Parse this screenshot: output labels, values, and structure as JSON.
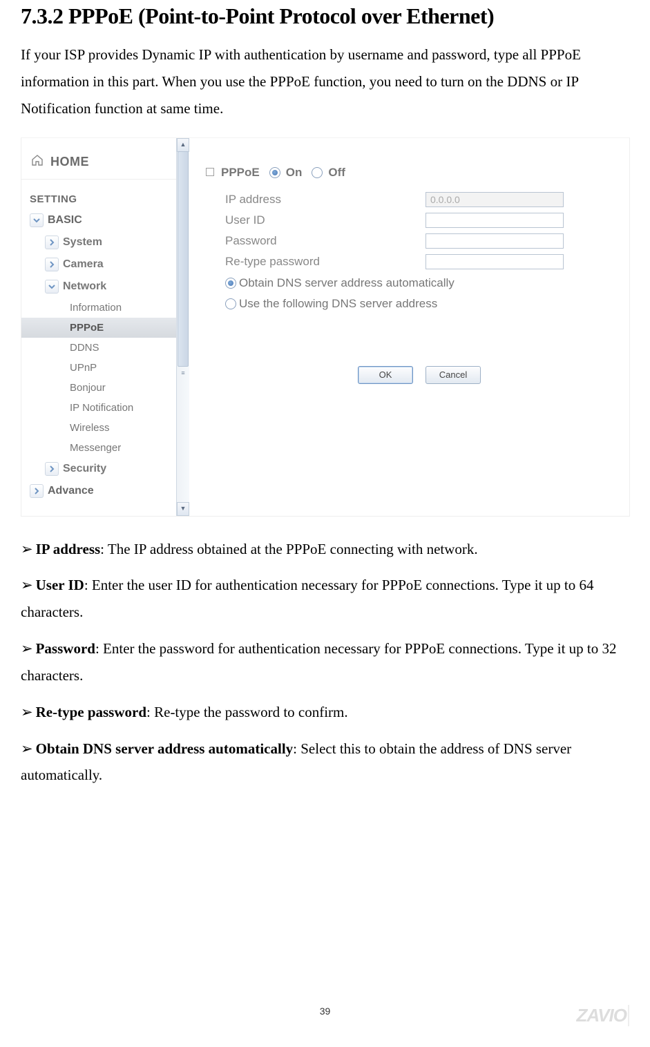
{
  "heading": "7.3.2 PPPoE (Point-to-Point Protocol over Ethernet)",
  "intro": "If your ISP provides Dynamic IP with authentication by username and password, type all PPPoE information in this part. When you use the PPPoE function, you need to turn on the DDNS or IP Notification function at same time.",
  "nav": {
    "home": "HOME",
    "settingHeader": "SETTING",
    "basic": "BASIC",
    "system": "System",
    "camera": "Camera",
    "network": "Network",
    "items": {
      "information": "Information",
      "pppoe": "PPPoE",
      "ddns": "DDNS",
      "upnp": "UPnP",
      "bonjour": "Bonjour",
      "ipnotification": "IP Notification",
      "wireless": "Wireless",
      "messenger": "Messenger"
    },
    "security": "Security",
    "advance": "Advance"
  },
  "form": {
    "sectionLabel": "PPPoE",
    "onLabel": "On",
    "offLabel": "Off",
    "ipaddressLabel": "IP address",
    "ipaddressValue": "0.0.0.0",
    "useridLabel": "User ID",
    "useridValue": "",
    "passwordLabel": "Password",
    "passwordValue": "",
    "retypeLabel": "Re-type password",
    "retypeValue": "",
    "dnsAuto": "Obtain DNS server address automatically",
    "dnsManual": "Use the following DNS server address",
    "okLabel": "OK",
    "cancelLabel": "Cancel"
  },
  "defs": {
    "ipaddress": {
      "term": "IP address",
      "text": ": The IP address obtained at the PPPoE connecting with network."
    },
    "userid": {
      "term": "User ID",
      "text": ": Enter the user ID for authentication necessary for PPPoE connections. Type it up to 64 characters."
    },
    "password": {
      "term": "Password",
      "text": ": Enter the password for authentication necessary for PPPoE connections. Type it up to 32 characters."
    },
    "retype": {
      "term": "Re-type password",
      "text": ": Re-type the password to confirm."
    },
    "dnsauto": {
      "term": "Obtain DNS server address automatically",
      "text": ": Select this to obtain the address of DNS server automatically."
    }
  },
  "pageNumber": "39",
  "brand": "ZAVIO"
}
